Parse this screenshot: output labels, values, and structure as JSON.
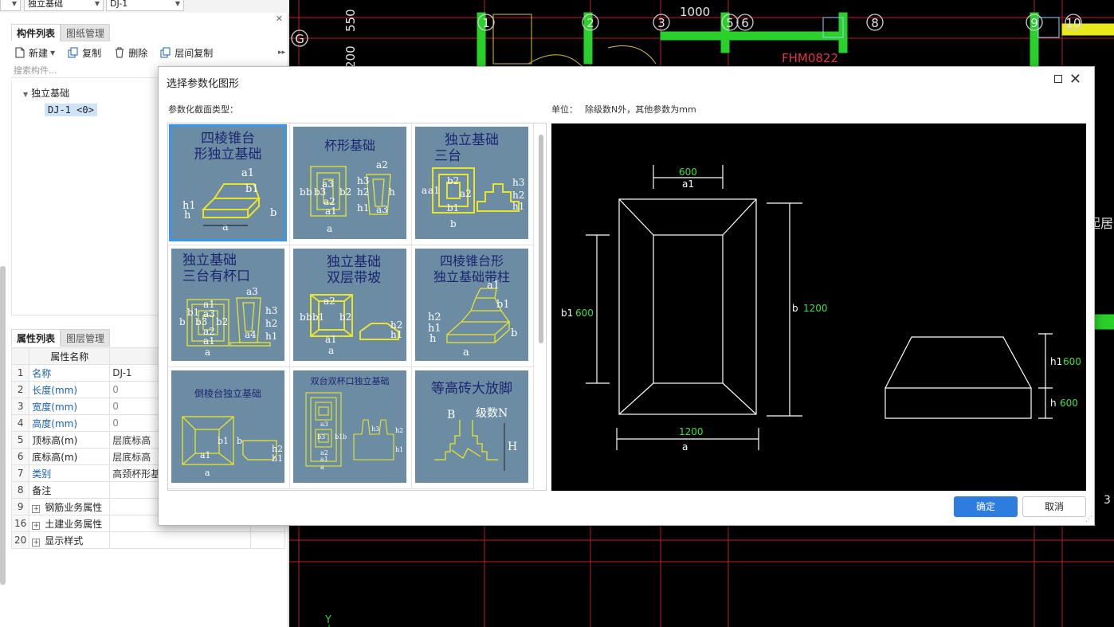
{
  "topbar": {
    "combo1": "独立基础",
    "combo2": "DJ-1"
  },
  "left_panel": {
    "tabs": [
      "构件列表",
      "图纸管理"
    ],
    "toolbar": {
      "new": "新建",
      "copy": "复制",
      "delete": "删除",
      "floor_copy": "层间复制"
    },
    "search_placeholder": "搜索构件...",
    "tree": {
      "root": "独立基础",
      "child": "DJ-1 <0>"
    }
  },
  "properties": {
    "tabs": [
      "属性列表",
      "图层管理"
    ],
    "header": "属性名称",
    "rows": [
      {
        "num": "1",
        "name": "名称",
        "value": "DJ-1"
      },
      {
        "num": "2",
        "name": "长度(mm)",
        "value": "0"
      },
      {
        "num": "3",
        "name": "宽度(mm)",
        "value": "0"
      },
      {
        "num": "4",
        "name": "高度(mm)",
        "value": "0"
      },
      {
        "num": "5",
        "name": "顶标高(m)",
        "value": "层底标高"
      },
      {
        "num": "6",
        "name": "底标高(m)",
        "value": "层底标高"
      },
      {
        "num": "7",
        "name": "类别",
        "value": "高颈杯形基"
      },
      {
        "num": "8",
        "name": "备注",
        "value": ""
      },
      {
        "num": "9",
        "name": "钢筋业务属性",
        "value": ""
      },
      {
        "num": "16",
        "name": "土建业务属性",
        "value": ""
      },
      {
        "num": "20",
        "name": "显示样式",
        "value": ""
      }
    ]
  },
  "cad": {
    "grid_labels": [
      "G",
      "1",
      "2",
      "3",
      "5",
      "6",
      "8",
      "9",
      "10"
    ],
    "dims": [
      "550",
      "200",
      "1000"
    ],
    "door_label": "FHM0822",
    "side_text": "起居",
    "axis_y": "Y",
    "right_digit": "3"
  },
  "dialog": {
    "title": "选择参数化图形",
    "section_label": "参数化截面类型：",
    "unit_label": "单位：",
    "unit_value": "除级数N外，其他参数为mm",
    "ok": "确定",
    "cancel": "取消",
    "shapes": [
      {
        "line1": "四棱锥台",
        "line2": "形独立基础"
      },
      {
        "line1": "杯形基础",
        "line2": ""
      },
      {
        "line1": "独立基础",
        "line2": "三台"
      },
      {
        "line1": "独立基础",
        "line2": "三台有杯口"
      },
      {
        "line1": "独立基础",
        "line2": "双层带坡"
      },
      {
        "line1": "四棱锥台形",
        "line2": "独立基础带柱"
      },
      {
        "line1": "倒棱台独立基础",
        "line2": ""
      },
      {
        "line1": "双台双杯口独立基础",
        "line2": ""
      },
      {
        "line1": "等高砖大放脚",
        "line2": ""
      }
    ],
    "thumb_labels": {
      "a": "a",
      "b": "b",
      "a1": "a1",
      "b1": "b1",
      "h": "h",
      "h1": "h1",
      "h2": "h2",
      "h3": "h3",
      "a2": "a2",
      "a3": "a3",
      "b2": "b2",
      "b3": "b3",
      "a4": "a4",
      "H": "H",
      "B": "B",
      "N": "级数N"
    },
    "preview": {
      "a1_value": "600",
      "a1_label": "a1",
      "b1_label": "b1",
      "b1_value": "600",
      "b_label": "b",
      "b_value": "1200",
      "a_value": "1200",
      "a_label": "a",
      "h1_label": "h1",
      "h1_value": "600",
      "h_label": "h",
      "h_value": "600"
    }
  }
}
